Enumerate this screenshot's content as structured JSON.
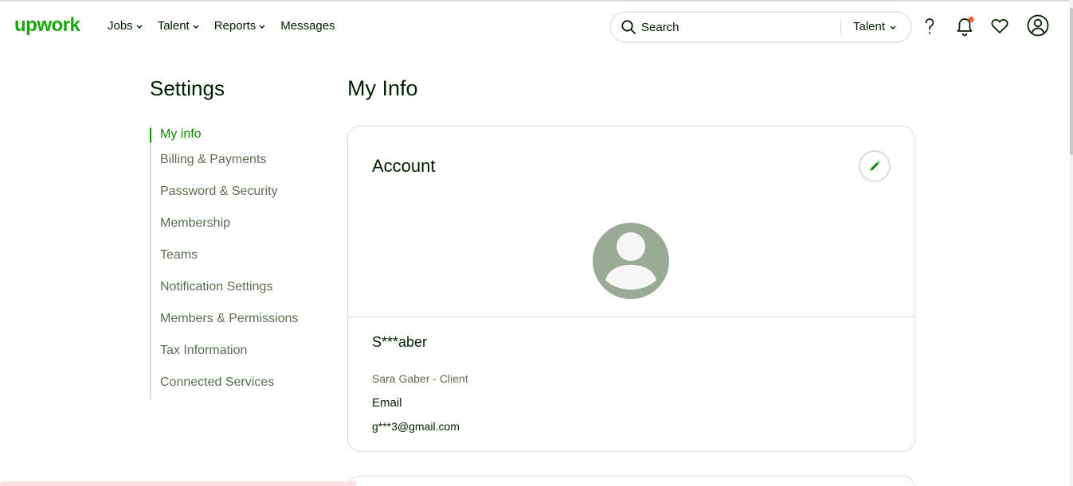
{
  "header": {
    "logo": "upwork",
    "nav": [
      {
        "label": "Jobs",
        "has_dropdown": true
      },
      {
        "label": "Talent",
        "has_dropdown": true
      },
      {
        "label": "Reports",
        "has_dropdown": true
      },
      {
        "label": "Messages",
        "has_dropdown": false
      }
    ],
    "search": {
      "placeholder": "Search",
      "scope": "Talent"
    },
    "icons": [
      "help-icon",
      "notification-bell-icon",
      "heart-icon",
      "user-account-icon"
    ],
    "brand_color": "#14a800",
    "notification_dot_color": "#f1592a"
  },
  "sidebar": {
    "title": "Settings",
    "items": [
      {
        "label": "My info",
        "active": true
      },
      {
        "label": "Billing & Payments",
        "active": false
      },
      {
        "label": "Password & Security",
        "active": false
      },
      {
        "label": "Membership",
        "active": false
      },
      {
        "label": "Teams",
        "active": false
      },
      {
        "label": "Notification Settings",
        "active": false
      },
      {
        "label": "Members & Permissions",
        "active": false
      },
      {
        "label": "Tax Information",
        "active": false
      },
      {
        "label": "Connected Services",
        "active": false
      }
    ]
  },
  "main": {
    "title": "My Info",
    "account": {
      "title": "Account",
      "name": "S***aber",
      "role": "Sara Gaber - Client",
      "email_label": "Email",
      "email": "g***3@gmail.com"
    }
  }
}
